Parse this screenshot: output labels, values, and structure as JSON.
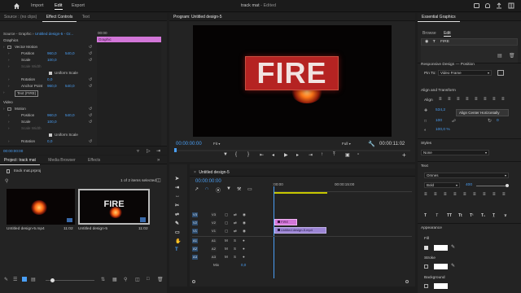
{
  "topbar": {
    "home_icon": "home-icon",
    "tabs": [
      "Import",
      "Edit",
      "Export"
    ],
    "active_tab": "Edit",
    "title": "track mat",
    "status": "- Edited",
    "right_icons": [
      "fullscreen-icon",
      "notification-icon",
      "quick-export-icon",
      "workspace-icon"
    ]
  },
  "source_panel": {
    "tabs": [
      "Source : (no clips)",
      "Effect Controls",
      "Text"
    ],
    "breadcrumb_source": "Source - Graphic",
    "breadcrumb_seq": "Untitled design-5 - Gr...",
    "timecode_ruler": "00:00",
    "clip_label": "Graphic",
    "section_graphics": "Graphics",
    "rows": [
      {
        "name": "Vector Motion",
        "indent": 1,
        "fx": true,
        "values": []
      },
      {
        "name": "Position",
        "indent": 2,
        "values": [
          "960,0",
          "540,0"
        ]
      },
      {
        "name": "Scale",
        "indent": 2,
        "values": [
          "100,0"
        ]
      },
      {
        "name": "Scale Width",
        "indent": 2,
        "values": [],
        "dim": true
      },
      {
        "name": "Uniform Scale",
        "indent": 0,
        "checkbox": true,
        "values": []
      },
      {
        "name": "Rotation",
        "indent": 2,
        "values": [
          "0,0"
        ]
      },
      {
        "name": "Anchor Point",
        "indent": 2,
        "values": [
          "960,0",
          "540,0"
        ]
      },
      {
        "name": "Text (FIRE)",
        "indent": 1,
        "values": [],
        "boxed": true
      }
    ],
    "section_video": "Video",
    "video_rows": [
      {
        "name": "Motion",
        "indent": 1,
        "fx": true,
        "values": []
      },
      {
        "name": "Position",
        "indent": 2,
        "values": [
          "960,0",
          "540,0"
        ]
      },
      {
        "name": "Scale",
        "indent": 2,
        "values": [
          "100,0"
        ]
      },
      {
        "name": "Scale Width",
        "indent": 2,
        "values": [],
        "dim": true
      },
      {
        "name": "Uniform Scale",
        "indent": 0,
        "checkbox": true,
        "values": []
      },
      {
        "name": "Rotation",
        "indent": 2,
        "values": [
          "0,0"
        ]
      }
    ],
    "bottom_timecode": "00:00:00:00"
  },
  "program": {
    "title": "Program: Untitled design-5",
    "overlay_text": "FIRE",
    "timecode": "00:00:00:00",
    "fit": "Fit",
    "quality": "Full",
    "duration": "00:00:11:02",
    "transport_icons": [
      "marker-icon",
      "in-point-icon",
      "out-point-icon",
      "go-to-in-icon",
      "step-back-icon",
      "play-icon",
      "step-forward-icon",
      "go-to-out-icon",
      "lift-icon",
      "extract-icon",
      "export-frame-icon",
      "comparison-icon"
    ]
  },
  "project_panel": {
    "tabs": [
      "Project: track mat",
      "Media Browser",
      "Effects"
    ],
    "filename": "track mat.prproj",
    "selection": "1 of 2 items selected",
    "items": [
      {
        "name": "Untitled design-5.mp4",
        "duration": "11:02",
        "has_text": false
      },
      {
        "name": "Untitled design-5",
        "duration": "11:02",
        "has_text": true,
        "thumb_text": "FIRE"
      }
    ]
  },
  "timeline": {
    "tab": "Untitled design-5",
    "timecode": "00:00:00:00",
    "ruler_start": ":00:00",
    "ruler_mid": "00:00:15:00",
    "video_tracks": [
      "V3",
      "V2",
      "V1"
    ],
    "audio_tracks": [
      "A1",
      "A2",
      "A3"
    ],
    "mix_label": "Mix",
    "mix_value": "0,0",
    "clip_v2": "FIRE",
    "clip_v1": "Untitled design-5.mp4"
  },
  "essential_graphics": {
    "title": "Essential Graphics",
    "tabs": [
      "Browse",
      "Edit"
    ],
    "active_tab": "Edit",
    "layer_name": "FIRE",
    "responsive_title": "Responsive Design — Position",
    "pin_to_label": "Pin To:",
    "pin_to_value": "Video Frame",
    "align_title": "Align and Transform",
    "align_label": "Align",
    "tooltip": "Align Center Horizontally",
    "pos_x": "534,2",
    "pos_y": "",
    "scale_value": "100",
    "rotation_value": "0",
    "opacity_value": "100,0 %",
    "styles_title": "Styles",
    "styles_value": "None",
    "text_title": "Text",
    "font_family": "Omnes",
    "font_style": "Bold",
    "font_size": "400",
    "appearance_title": "Appearance",
    "fill_label": "Fill",
    "stroke_label": "Stroke",
    "background_label": "Background",
    "accent_color": "#4a9ff5"
  },
  "colors": {
    "clip_pink": "#d276d8",
    "clip_violet": "#9c85d4",
    "track_blue": "#2e4d6f",
    "fire_red": "#b52322"
  }
}
